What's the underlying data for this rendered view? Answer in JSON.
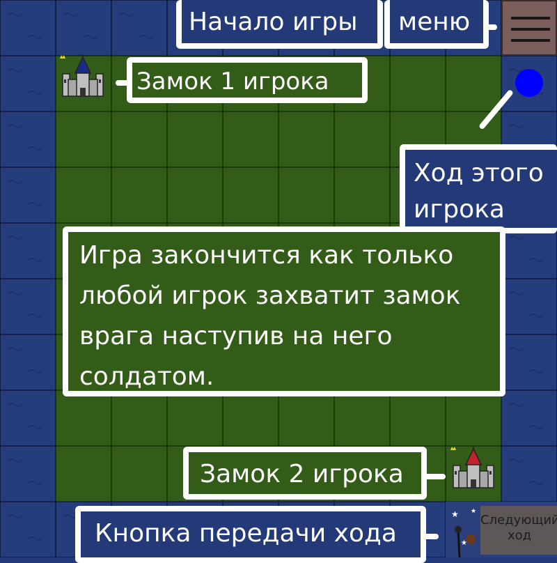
{
  "callouts": {
    "game_start": "Начало игры",
    "menu": "меню",
    "castle1": "Замок 1 игрока",
    "current_player": "Ход этого игрока",
    "rules": "Игра закончится как только любой игрок захватит замок врага наступив на него солдатом.",
    "castle2": "Замок 2 игрока",
    "next_turn_button": "Кнопка передачи хода"
  },
  "hud": {
    "next_turn_line1": "Следующий",
    "next_turn_line2": "ход",
    "menu_icon": "hamburger-icon",
    "turn_indicator_color": "#0000ff",
    "player1_color": "#1a2a8a",
    "player2_color": "#c2222a"
  },
  "colors": {
    "water": "#253d7d",
    "grass": "#325c17",
    "callout_border": "#ffffff",
    "menu_button": "#7a5e5c"
  }
}
